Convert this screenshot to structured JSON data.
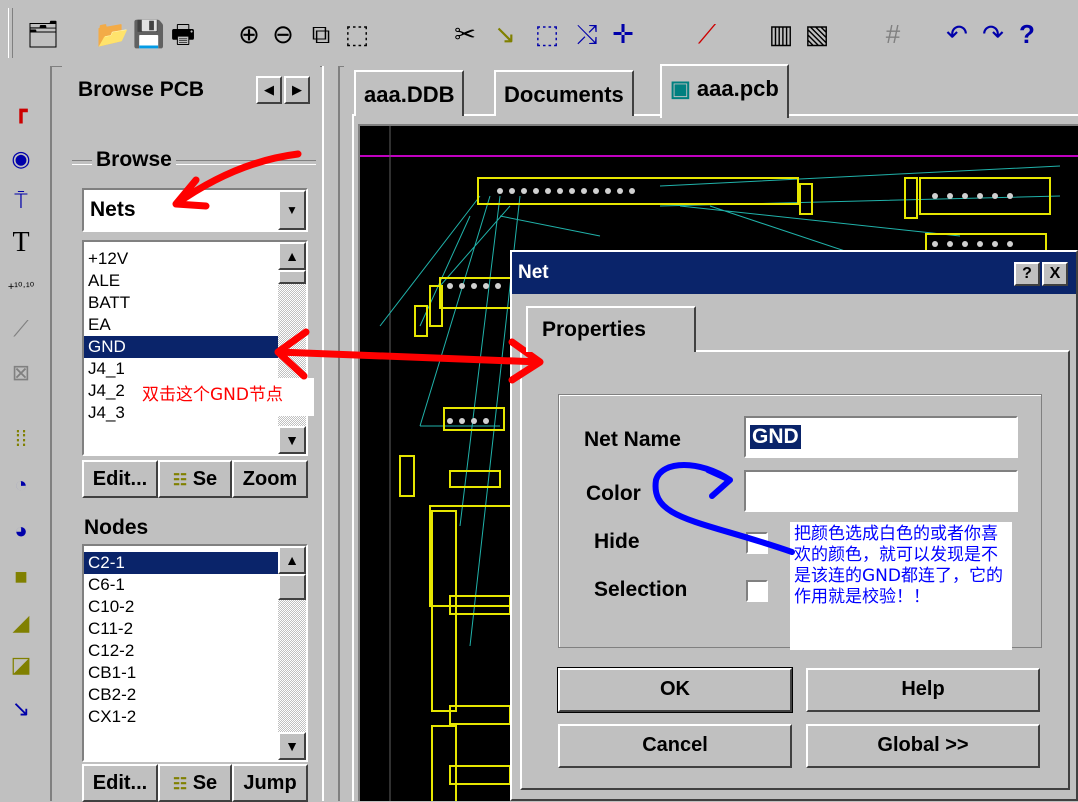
{
  "toolbar": {
    "icons": [
      "layer-stack-icon",
      "open-folder-icon",
      "save-icon",
      "print-icon",
      "zoom-in-icon",
      "zoom-out-icon",
      "zoom-fit-icon",
      "zoom-area-icon",
      "cut-wire-icon",
      "route-icon",
      "select-rect-icon",
      "deselect-icon",
      "move-icon",
      "wand-icon",
      "library-icon",
      "library-edit-icon",
      "grid-icon",
      "undo-icon",
      "redo-icon",
      "help-icon"
    ]
  },
  "browser_panel": {
    "tab_label": "Browse PCB",
    "group_title": "Browse",
    "filter_value": "Nets",
    "nets": [
      "+12V",
      "ALE",
      "BATT",
      "EA",
      "GND",
      "J4_1",
      "J4_2",
      "J4_3"
    ],
    "selected_net": "GND",
    "net_buttons": {
      "edit": "Edit...",
      "select": "Se",
      "zoom": "Zoom"
    },
    "nodes_title": "Nodes",
    "nodes": [
      "C2-1",
      "C6-1",
      "C10-2",
      "C11-2",
      "C12-2",
      "CB1-1",
      "CB2-2",
      "CX1-2"
    ],
    "node_buttons": {
      "edit": "Edit...",
      "select": "Se",
      "jump": "Jump"
    }
  },
  "document_tabs": [
    "aaa.DDB",
    "Documents",
    "aaa.pcb"
  ],
  "dialog": {
    "title": "Net",
    "title_buttons": {
      "help": "?",
      "close": "X"
    },
    "tab": "Properties",
    "net_name_label": "Net Name",
    "net_name_value": "GND",
    "color_label": "Color",
    "hide_label": "Hide",
    "selection_label": "Selection",
    "ok": "OK",
    "help": "Help",
    "cancel": "Cancel",
    "global": "Global >>"
  },
  "annotations": {
    "double_click_note": "双击这个GND节点",
    "color_note": "把颜色选成白色的或者你喜欢的颜色，就可以发现是不是该连的GND都连了，它的作用就是校验！！"
  },
  "colors": {
    "selection": "#0a246a",
    "pcb_bg": "#000000",
    "pcb_component": "#e6e600",
    "ratsnest": "#20b2aa",
    "annotation_red": "#ff0000",
    "annotation_blue": "#0000ff"
  }
}
